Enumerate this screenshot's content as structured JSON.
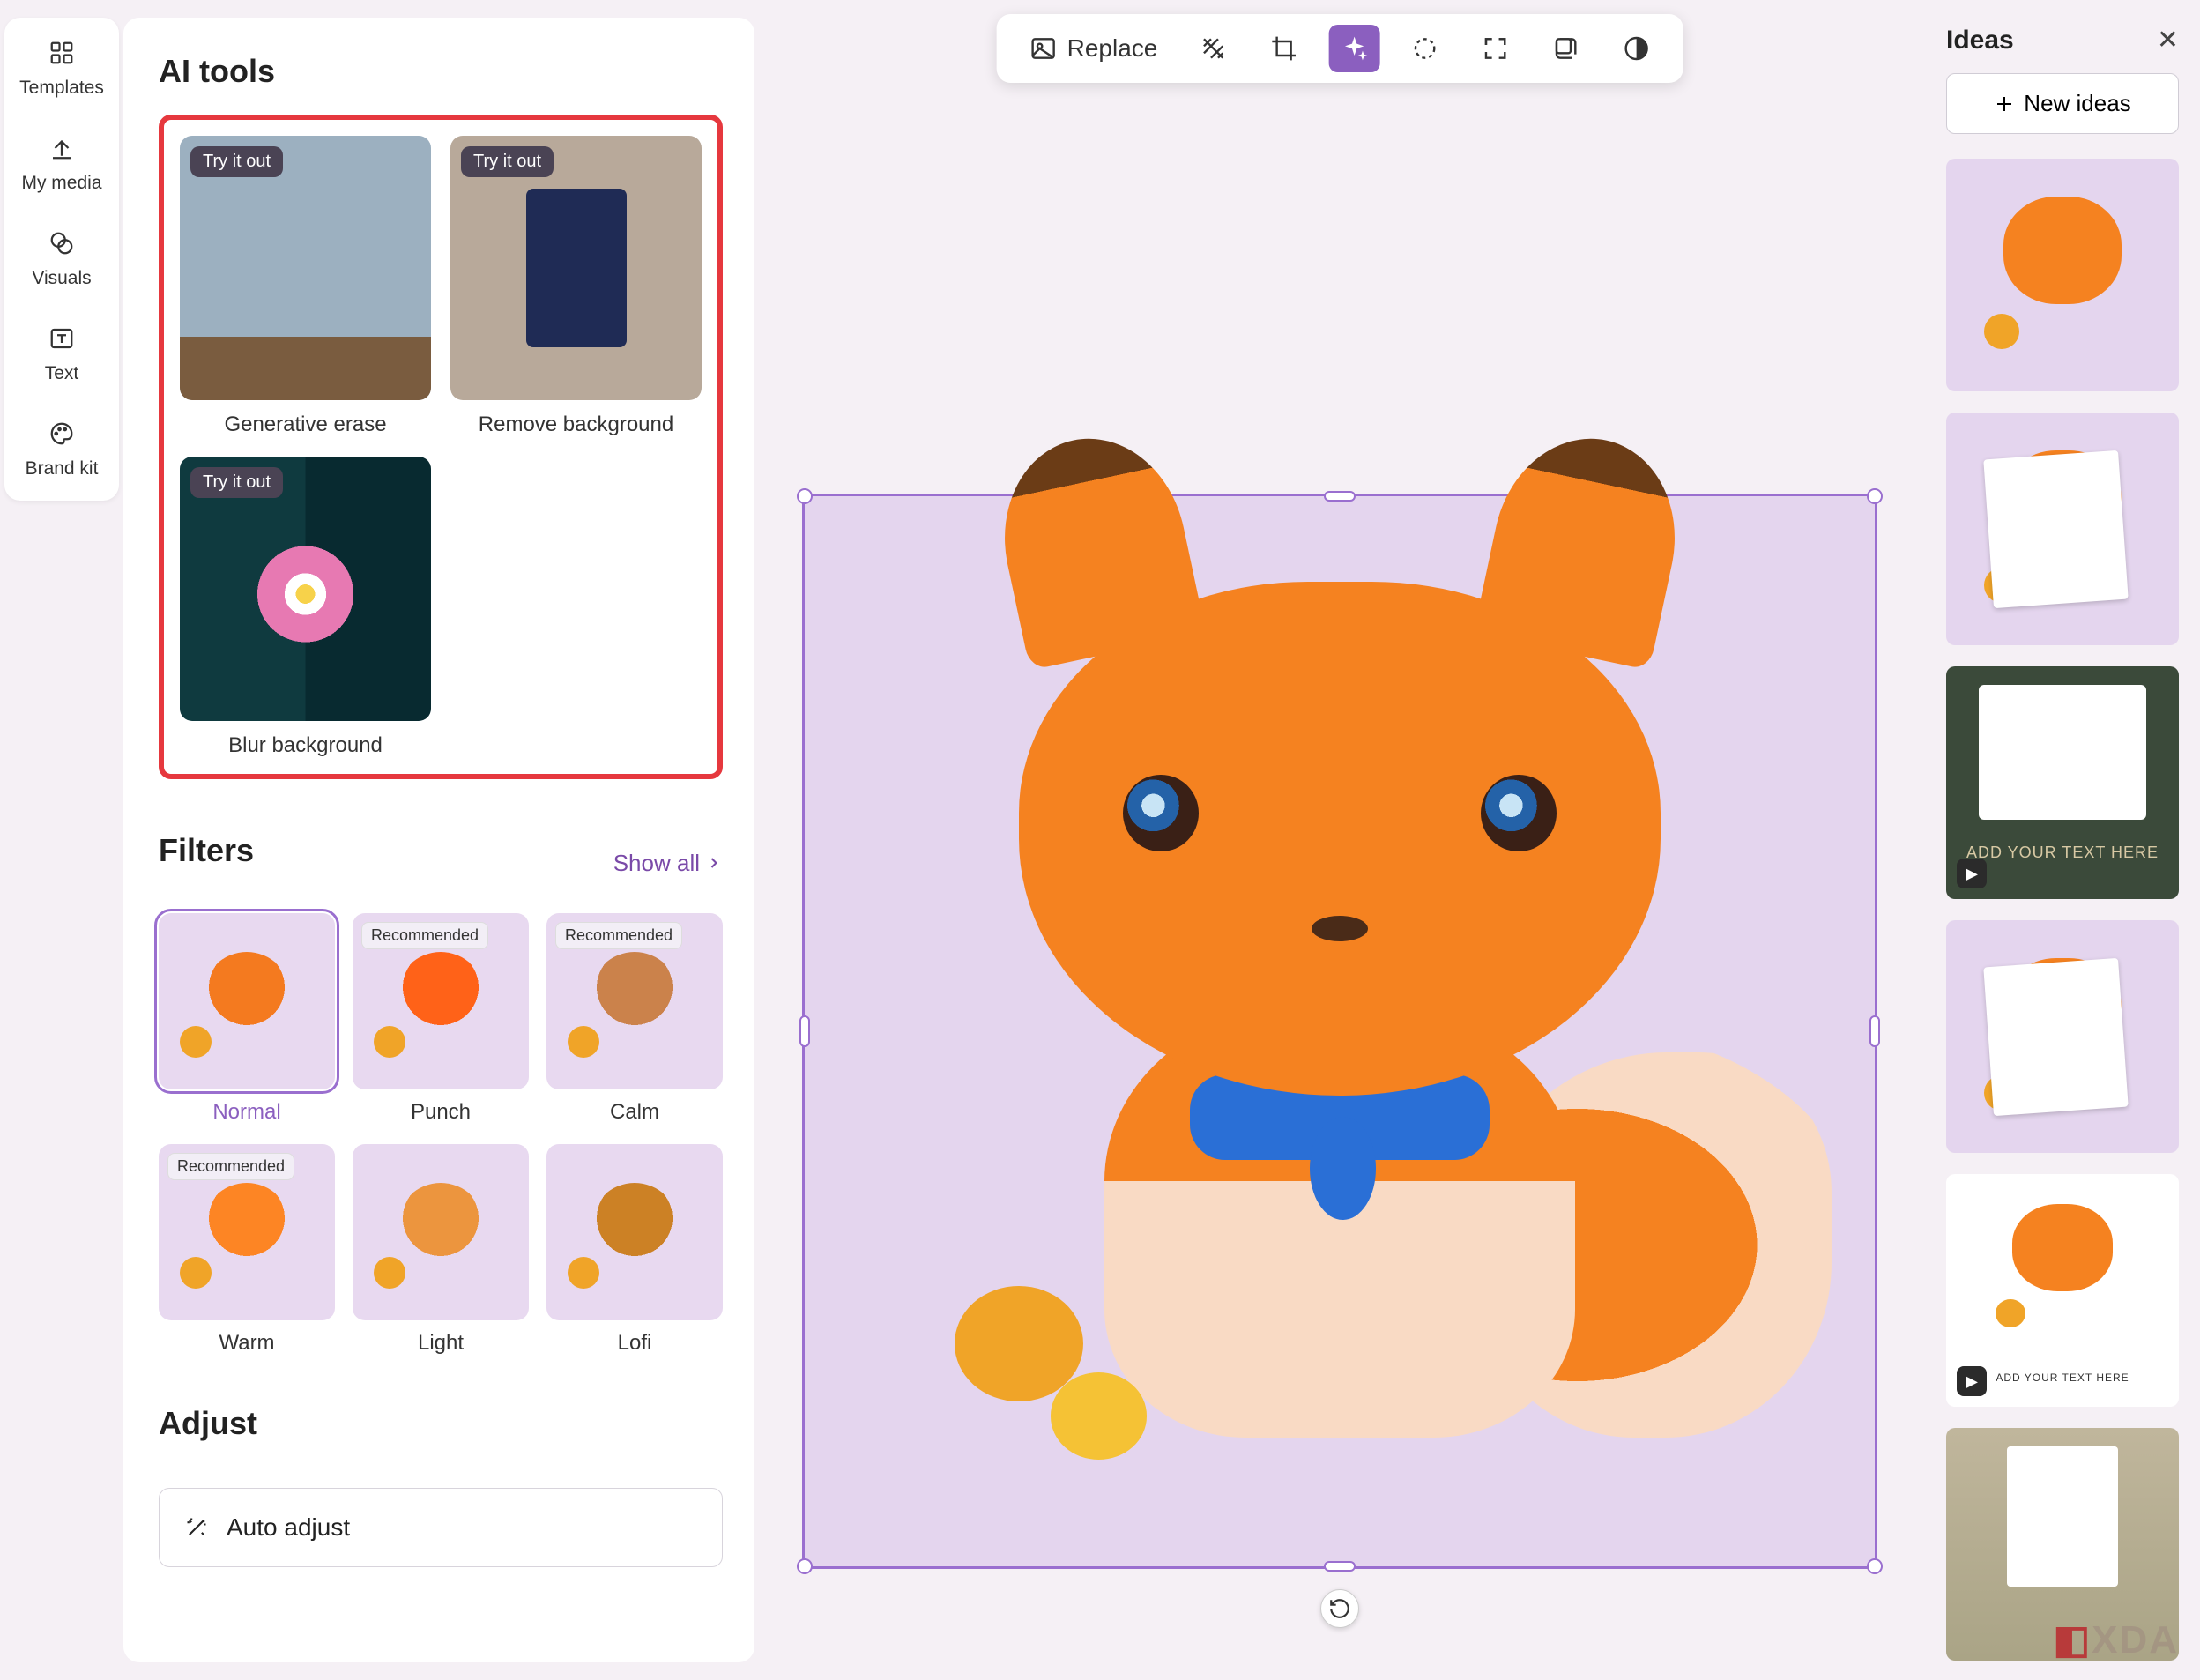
{
  "nav": {
    "templates": "Templates",
    "my_media": "My media",
    "visuals": "Visuals",
    "text": "Text",
    "brand_kit": "Brand kit"
  },
  "ai_tools": {
    "heading": "AI tools",
    "try_it_out": "Try it out",
    "generative_erase": "Generative erase",
    "remove_background": "Remove background",
    "blur_background": "Blur background"
  },
  "filters": {
    "heading": "Filters",
    "show_all": "Show all",
    "recommended": "Recommended",
    "items": {
      "normal": "Normal",
      "punch": "Punch",
      "calm": "Calm",
      "warm": "Warm",
      "light": "Light",
      "lofi": "Lofi"
    }
  },
  "adjust": {
    "heading": "Adjust",
    "auto_adjust": "Auto adjust"
  },
  "toolbar": {
    "replace": "Replace"
  },
  "ideas": {
    "heading": "Ideas",
    "new_ideas": "New ideas",
    "template_text_1": "ADD YOUR TEXT HERE",
    "template_text_2": "ADD YOUR TEXT HERE"
  },
  "watermark": "XDA"
}
